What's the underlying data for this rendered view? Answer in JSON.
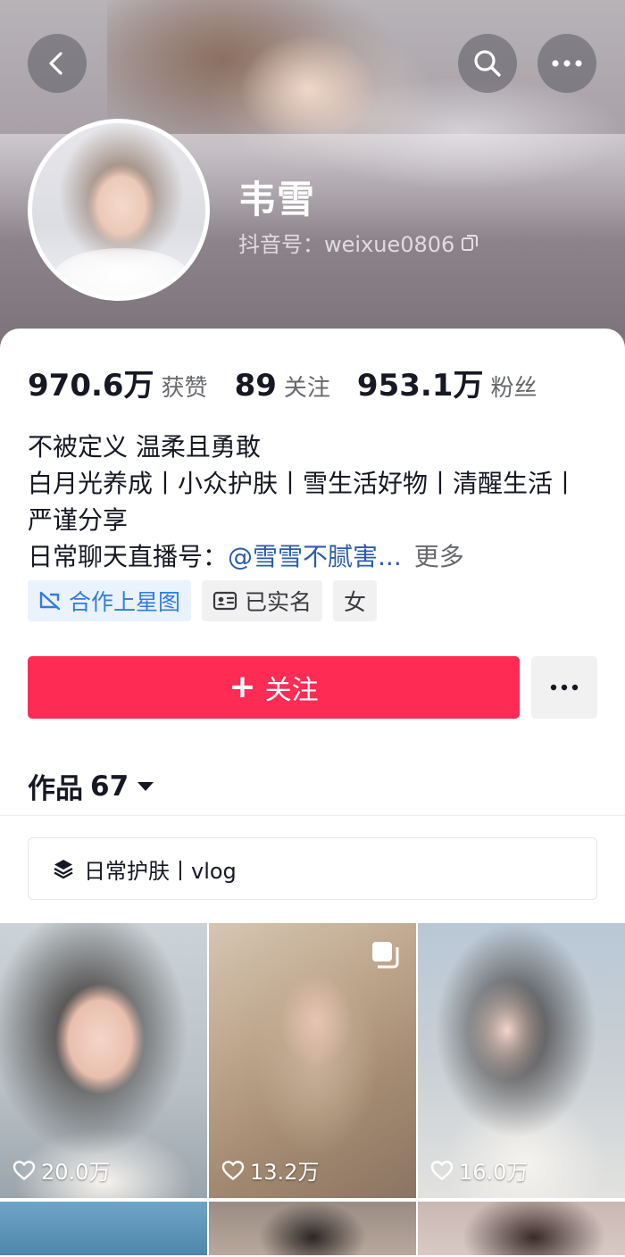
{
  "header": {
    "back_icon": "chevron-left-icon",
    "search_icon": "search-icon",
    "more_icon": "more-horizontal-icon"
  },
  "profile": {
    "name": "韦雪",
    "douyin_id": "抖音号：weixue0806",
    "copy_icon": "copy-icon"
  },
  "stats": [
    {
      "value": "970.6万",
      "label": "获赞"
    },
    {
      "value": "89",
      "label": "关注"
    },
    {
      "value": "953.1万",
      "label": "粉丝"
    }
  ],
  "bio": {
    "line1": "不被定义 温柔且勇敢",
    "line2": "白月光养成丨小众护肤丨雪生活好物丨清醒生活丨严谨分享",
    "line3_prefix": "日常聊天直播号：",
    "line3_mention": "@雪雪不腻害...",
    "more": "更多"
  },
  "tags": [
    {
      "label": "合作上星图",
      "icon": "star-map-icon",
      "color": "#2f7de1"
    },
    {
      "label": "已实名",
      "icon": "id-card-icon"
    },
    {
      "label": "女"
    }
  ],
  "actions": {
    "follow_label": "关注",
    "follow_color": "#fe2c55",
    "more_icon": "more-horizontal-icon"
  },
  "works": {
    "label": "作品",
    "count": "67"
  },
  "collection": {
    "icon": "layers-icon",
    "label": "日常护肤丨vlog"
  },
  "videos": [
    {
      "likes": "20.0万",
      "multi_image": false
    },
    {
      "likes": "13.2万",
      "multi_image": true
    },
    {
      "likes": "16.0万",
      "multi_image": false
    }
  ]
}
